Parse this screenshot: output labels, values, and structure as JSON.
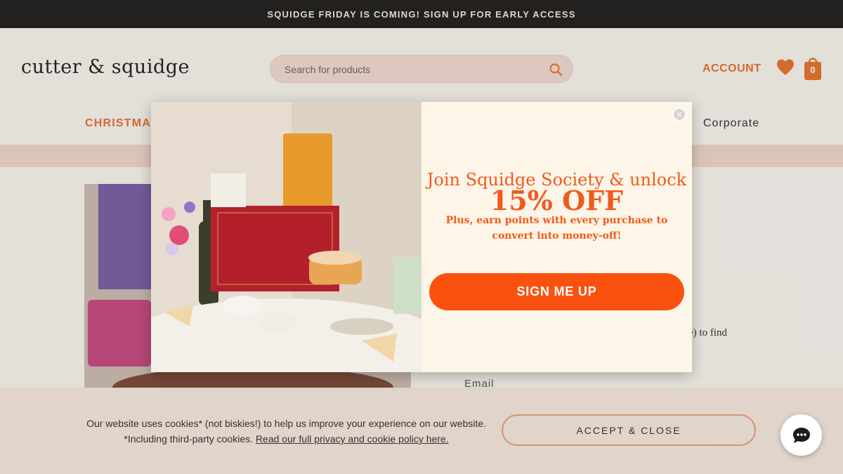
{
  "promo_bar": {
    "text": "SQUIDGE FRIDAY IS COMING! SIGN UP FOR EARLY ACCESS"
  },
  "header": {
    "logo": "cutter & squidge",
    "search_placeholder": "Search for products",
    "account_label": "ACCOUNT",
    "cart_count": "0"
  },
  "nav": {
    "christmas": "CHRISTMAS",
    "corporate": "Corporate"
  },
  "content": {
    "body_fragment": "e) to find",
    "email_label": "Email"
  },
  "popup": {
    "heading": "Join Squidge Society & unlock",
    "offer": "15% OFF",
    "subtext": "Plus, earn points with every purchase to convert into money-off!",
    "cta_label": "SIGN ME UP"
  },
  "cookie_banner": {
    "line1": "Our website uses cookies* (not biskies!) to help us improve your experience on our website.",
    "line2_prefix": "*Including third-party cookies.",
    "link_text": "Read our full privacy and cookie policy here.",
    "accept_label": "ACCEPT & CLOSE"
  },
  "colors": {
    "brand_orange": "#fa520e",
    "accent": "#e8742e",
    "popup_bg": "#fdf5e8",
    "promo_bg": "#1f1f1f"
  },
  "icons": [
    "search-icon",
    "heart-icon",
    "shopping-bag-icon",
    "close-icon",
    "chat-icon"
  ]
}
